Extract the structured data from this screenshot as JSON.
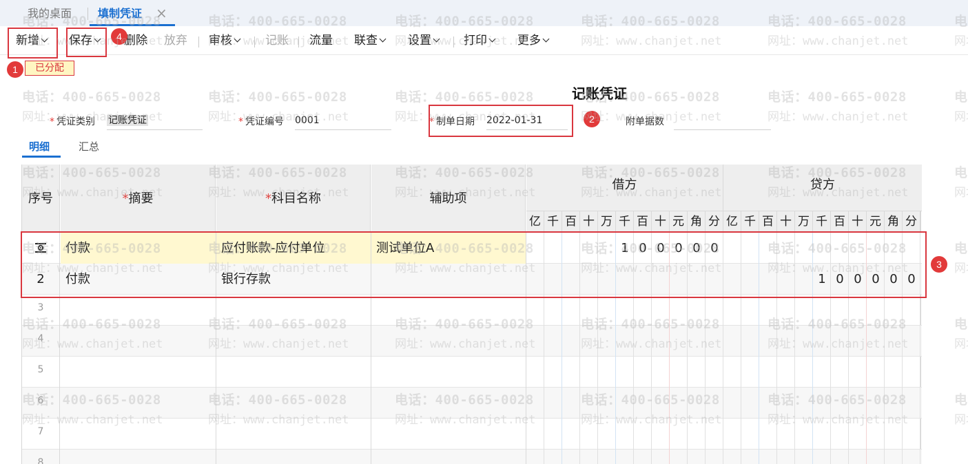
{
  "tabs": {
    "desktop": "我的桌面",
    "voucher": "填制凭证",
    "close_glyph": "×"
  },
  "toolbar": [
    {
      "label": "新增",
      "dropdown": true,
      "disabled": false
    },
    {
      "label": "保存",
      "dropdown": true,
      "disabled": false
    },
    {
      "label": "删除",
      "dropdown": false,
      "disabled": false
    },
    {
      "label": "放弃",
      "dropdown": false,
      "disabled": true
    },
    {
      "label": "审核",
      "dropdown": true,
      "disabled": false
    },
    {
      "label": "记账",
      "dropdown": false,
      "disabled": true
    },
    {
      "label": "流量",
      "dropdown": false,
      "disabled": false
    },
    {
      "label": "联查",
      "dropdown": true,
      "disabled": false
    },
    {
      "label": "设置",
      "dropdown": true,
      "disabled": false
    },
    {
      "label": "打印",
      "dropdown": true,
      "disabled": false
    },
    {
      "label": "更多",
      "dropdown": true,
      "disabled": false
    }
  ],
  "status_badge": "已分配",
  "markers": [
    "1",
    "2",
    "3",
    "4"
  ],
  "watermark": {
    "line1": "电话：400-665-0028",
    "line2": "网址：www.chanjet.net"
  },
  "voucher": {
    "title": "记账凭证",
    "type_label": "凭证类别",
    "type_value": "记账凭证",
    "number_label": "凭证编号",
    "number_value": "0001",
    "date_label": "制单日期",
    "date_value": "2022-01-31",
    "attachments_label": "附单据数",
    "attachments_value": ""
  },
  "subtabs": {
    "detail": "明细",
    "summary": "汇总"
  },
  "grid": {
    "headers": {
      "seq": "序号",
      "summary": "摘要",
      "account": "科目名称",
      "aux": "辅助项",
      "debit": "借方",
      "credit": "贷方"
    },
    "required_mark": "*",
    "digit_units": [
      "亿",
      "千",
      "百",
      "十",
      "万",
      "千",
      "百",
      "十",
      "元",
      "角",
      "分"
    ],
    "rows": [
      {
        "seq": "",
        "seq_icon": "row-settings-icon",
        "summary": "付款",
        "account": "应付账款-应付单位",
        "aux": "测试单位A",
        "debit": "100000",
        "credit": ""
      },
      {
        "seq": "2",
        "summary": "付款",
        "account": "银行存款",
        "aux": "",
        "debit": "",
        "credit": "100000"
      },
      {
        "seq": "3",
        "summary": "",
        "account": "",
        "aux": "",
        "debit": "",
        "credit": ""
      },
      {
        "seq": "4",
        "summary": "",
        "account": "",
        "aux": "",
        "debit": "",
        "credit": ""
      },
      {
        "seq": "5",
        "summary": "",
        "account": "",
        "aux": "",
        "debit": "",
        "credit": ""
      },
      {
        "seq": "6",
        "summary": "",
        "account": "",
        "aux": "",
        "debit": "",
        "credit": ""
      },
      {
        "seq": "7",
        "summary": "",
        "account": "",
        "aux": "",
        "debit": "",
        "credit": ""
      },
      {
        "seq": "8",
        "summary": "",
        "account": "",
        "aux": "",
        "debit": "",
        "credit": ""
      }
    ]
  }
}
